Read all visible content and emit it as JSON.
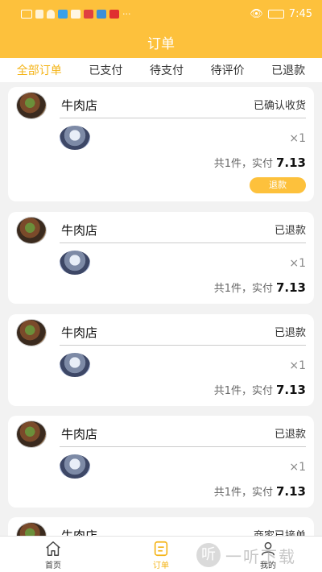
{
  "status_bar": {
    "time": "7:45"
  },
  "header": {
    "title": "订单"
  },
  "tabs": [
    {
      "label": "全部订单",
      "active": true
    },
    {
      "label": "已支付"
    },
    {
      "label": "待支付"
    },
    {
      "label": "待评价"
    },
    {
      "label": "已退款"
    }
  ],
  "orders": [
    {
      "shop": "牛肉店",
      "status": "已确认收货",
      "qty": "×1",
      "summary_prefix": "共1件，实付",
      "amount": "7.13",
      "action": "退款"
    },
    {
      "shop": "牛肉店",
      "status": "已退款",
      "qty": "×1",
      "summary_prefix": "共1件，实付",
      "amount": "7.13"
    },
    {
      "shop": "牛肉店",
      "status": "已退款",
      "qty": "×1",
      "summary_prefix": "共1件，实付",
      "amount": "7.13"
    },
    {
      "shop": "牛肉店",
      "status": "已退款",
      "qty": "×1",
      "summary_prefix": "共1件，实付",
      "amount": "7.13"
    },
    {
      "shop": "牛肉店",
      "status": "商家已接单"
    }
  ],
  "tabbar": [
    {
      "label": "首页",
      "icon": "home-icon"
    },
    {
      "label": "订单",
      "icon": "order-icon",
      "active": true
    },
    {
      "label": "我的",
      "icon": "profile-icon"
    }
  ],
  "watermark": {
    "text": "一听下载",
    "badge": "听"
  },
  "colors": {
    "accent": "#fdc13c",
    "accent_text": "#f4b418",
    "background": "#f2f2f2"
  }
}
